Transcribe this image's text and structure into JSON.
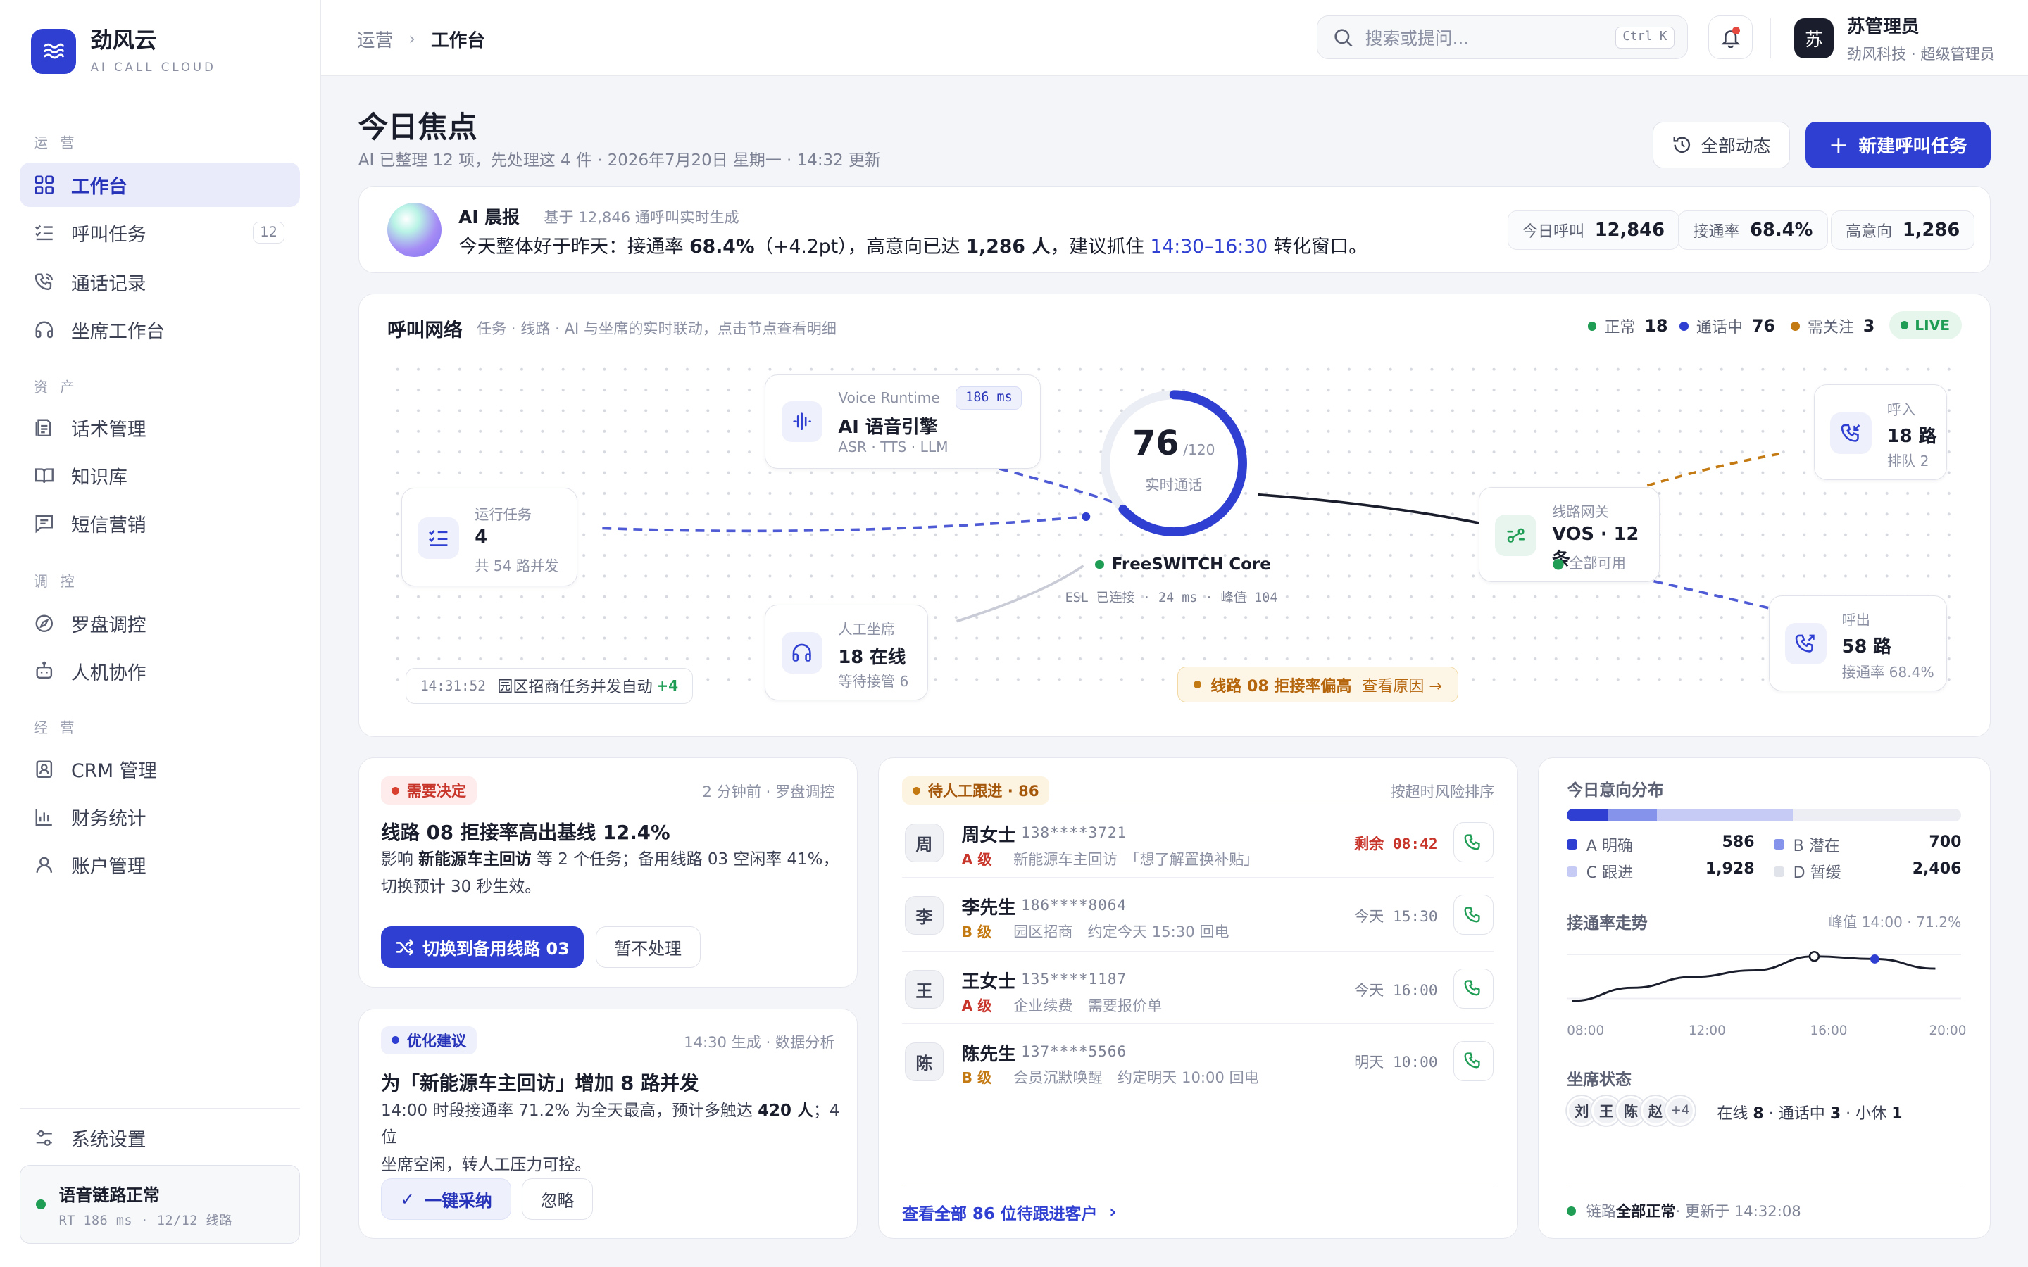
{
  "brand": {
    "name": "劲风云",
    "sub": "AI CALL CLOUD"
  },
  "sidebar": {
    "sections": [
      "运 营",
      "资 产",
      "调 控",
      "经 营"
    ],
    "items": [
      {
        "label": "工作台",
        "icon": "grid-icon",
        "active": true
      },
      {
        "label": "呼叫任务",
        "icon": "task-list-icon",
        "count": "12"
      },
      {
        "label": "通话记录",
        "icon": "phone-icon"
      },
      {
        "label": "坐席工作台",
        "icon": "headset-icon"
      },
      {
        "label": "话术管理",
        "icon": "script-icon"
      },
      {
        "label": "知识库",
        "icon": "book-icon"
      },
      {
        "label": "短信营销",
        "icon": "message-icon"
      },
      {
        "label": "罗盘调控",
        "icon": "compass-icon"
      },
      {
        "label": "人机协作",
        "icon": "robot-icon"
      },
      {
        "label": "CRM 管理",
        "icon": "contact-icon"
      },
      {
        "label": "财务统计",
        "icon": "bar-chart-icon"
      },
      {
        "label": "账户管理",
        "icon": "user-icon"
      }
    ],
    "settings": "系统设置",
    "status": {
      "title": "语音链路正常",
      "detail": "RT 186 ms · 12/12 线路"
    }
  },
  "topbar": {
    "breadcrumb": [
      "运营",
      "工作台"
    ],
    "search_placeholder": "搜索或提问...",
    "shortcut": "Ctrl K",
    "user": {
      "avatar": "苏",
      "name": "苏管理员",
      "role": "劲风科技 · 超级管理员"
    }
  },
  "header": {
    "title": "今日焦点",
    "subtitle": "AI 已整理 12 项，先处理这 4 件 · 2026年7月20日 星期一 · 14:32 更新",
    "all_activity": "全部动态",
    "new_task": "新建呼叫任务"
  },
  "brief": {
    "title": "AI 晨报",
    "source": "基于 12,846 通呼叫实时生成",
    "p1": "今天整体好于昨天：接通率 ",
    "rate": "68.4%",
    "p2": "（+4.2pt），高意向已达 ",
    "intent": "1,286 人",
    "p3": "，建议抓住 ",
    "window": "14:30–16:30",
    "p4": " 转化窗口。",
    "stats": [
      {
        "label": "今日呼叫",
        "value": "12,846"
      },
      {
        "label": "接通率",
        "value": "68.4%"
      },
      {
        "label": "高意向",
        "value": "1,286"
      }
    ]
  },
  "network": {
    "title": "呼叫网络",
    "subtitle": "任务 · 线路 · AI 与坐席的实时联动，点击节点查看明细",
    "legend": [
      {
        "label": "正常",
        "value": "18",
        "color": "#1f9d55"
      },
      {
        "label": "通话中",
        "value": "76",
        "color": "#2f3fd1"
      },
      {
        "label": "需关注",
        "value": "3",
        "color": "#c47a12"
      }
    ],
    "live": "LIVE",
    "tasks": {
      "label": "运行任务",
      "value": "4",
      "sub": "共 54 路并发"
    },
    "engine": {
      "label": "Voice Runtime",
      "value": "AI 语音引擎",
      "sub": "ASR · TTS · LLM",
      "badge": "186 ms"
    },
    "agents": {
      "label": "人工坐席",
      "value": "18 在线",
      "sub": "等待接管 6"
    },
    "core": {
      "value": "76",
      "max": "/120",
      "label": "实时通话",
      "name": "FreeSWITCH Core",
      "detail": "ESL 已连接 · 24 ms · 峰值 104",
      "utilization": 0.633
    },
    "gateway": {
      "label": "线路网关",
      "value": "VOS · 12 条",
      "sub": "全部可用"
    },
    "inbound": {
      "label": "呼入",
      "value": "18 路",
      "sub": "排队 2"
    },
    "outbound": {
      "label": "呼出",
      "value": "58 路",
      "sub": "接通率 68.4%"
    },
    "event": {
      "time": "14:31:52",
      "text": "园区招商任务并发自动",
      "delta": "+4"
    },
    "alert": {
      "text": "线路 08 拒接率偏高",
      "link": "查看原因 →"
    }
  },
  "decision": {
    "tag": "需要决定",
    "meta": "2 分钟前 · 罗盘调控",
    "title": "线路 08 拒接率高出基线 12.4%",
    "d1": "影响 ",
    "d_bold": "新能源车主回访",
    "d2": " 等 2 个任务；备用线路 03 空闲率 41%，",
    "d3": "切换预计 30 秒生效。",
    "primary": "切换到备用线路 03",
    "secondary": "暂不处理"
  },
  "suggestion": {
    "tag": "优化建议",
    "meta": "14:30 生成 · 数据分析",
    "title": "为「新能源车主回访」增加 8 路并发",
    "d1": "14:00 时段接通率 71.2% 为全天最高，预计多触达 ",
    "d_bold": "420 人",
    "d2": "；4 位",
    "d3": "坐席空闲，转人工压力可控。",
    "primary": "一键采纳",
    "secondary": "忽略"
  },
  "leads": {
    "tag": "待人工跟进 · 86",
    "sort": "按超时风险排序",
    "rows": [
      {
        "avatar": "周",
        "name": "周女士",
        "phone": "138****3721",
        "grade": "A 级",
        "desc": "新能源车主回访　「想了解置换补贴」",
        "time": "剩余 08:42",
        "urgent": true
      },
      {
        "avatar": "李",
        "name": "李先生",
        "phone": "186****8064",
        "grade": "B 级",
        "desc": "园区招商　约定今天 15:30 回电",
        "time": "今天 15:30"
      },
      {
        "avatar": "王",
        "name": "王女士",
        "phone": "135****1187",
        "grade": "A 级",
        "desc": "企业续费　需要报价单",
        "time": "今天 16:00"
      },
      {
        "avatar": "陈",
        "name": "陈先生",
        "phone": "137****5566",
        "grade": "B 级",
        "desc": "会员沉默唤醒　约定明天 10:00 回电",
        "time": "明天 10:00"
      }
    ],
    "view_all": "查看全部 86 位待跟进客户"
  },
  "insights": {
    "intent_title": "今日意向分布",
    "intent": [
      {
        "label": "A 明确",
        "value": 586,
        "color": "#2f3fd1"
      },
      {
        "label": "B 潜在",
        "value": 700,
        "color": "#8593ea"
      },
      {
        "label": "C 跟进",
        "value": 1928,
        "color": "#c5cbf5"
      },
      {
        "label": "D 暂缓",
        "value": 2406,
        "color": "#eceef4"
      }
    ],
    "intent_display": [
      "586",
      "700",
      "1,928",
      "2,406"
    ],
    "trend_title": "接通率走势",
    "trend_peak": "峰值 14:00 · 71.2%",
    "trend": {
      "x": [
        "08:00",
        "10:00",
        "12:00",
        "14:00",
        "16:00",
        "18:00",
        "20:00"
      ],
      "y": [
        61,
        64,
        66.5,
        68,
        71.2,
        70.6,
        68.4
      ]
    },
    "trend_axis": [
      "08:00",
      "12:00",
      "16:00",
      "20:00"
    ],
    "seat_title": "坐席状态",
    "seats": [
      "刘",
      "王",
      "陈",
      "赵",
      "+4"
    ],
    "seat_p1": "在线 ",
    "seat_online": "8",
    "seat_p2": " · 通话中 ",
    "seat_busy": "3",
    "seat_p3": " · 小休 ",
    "seat_rest": "1",
    "footer_p1": "链路 ",
    "footer_bold": "全部正常",
    "footer_p2": " · 更新于 14:32:08"
  }
}
